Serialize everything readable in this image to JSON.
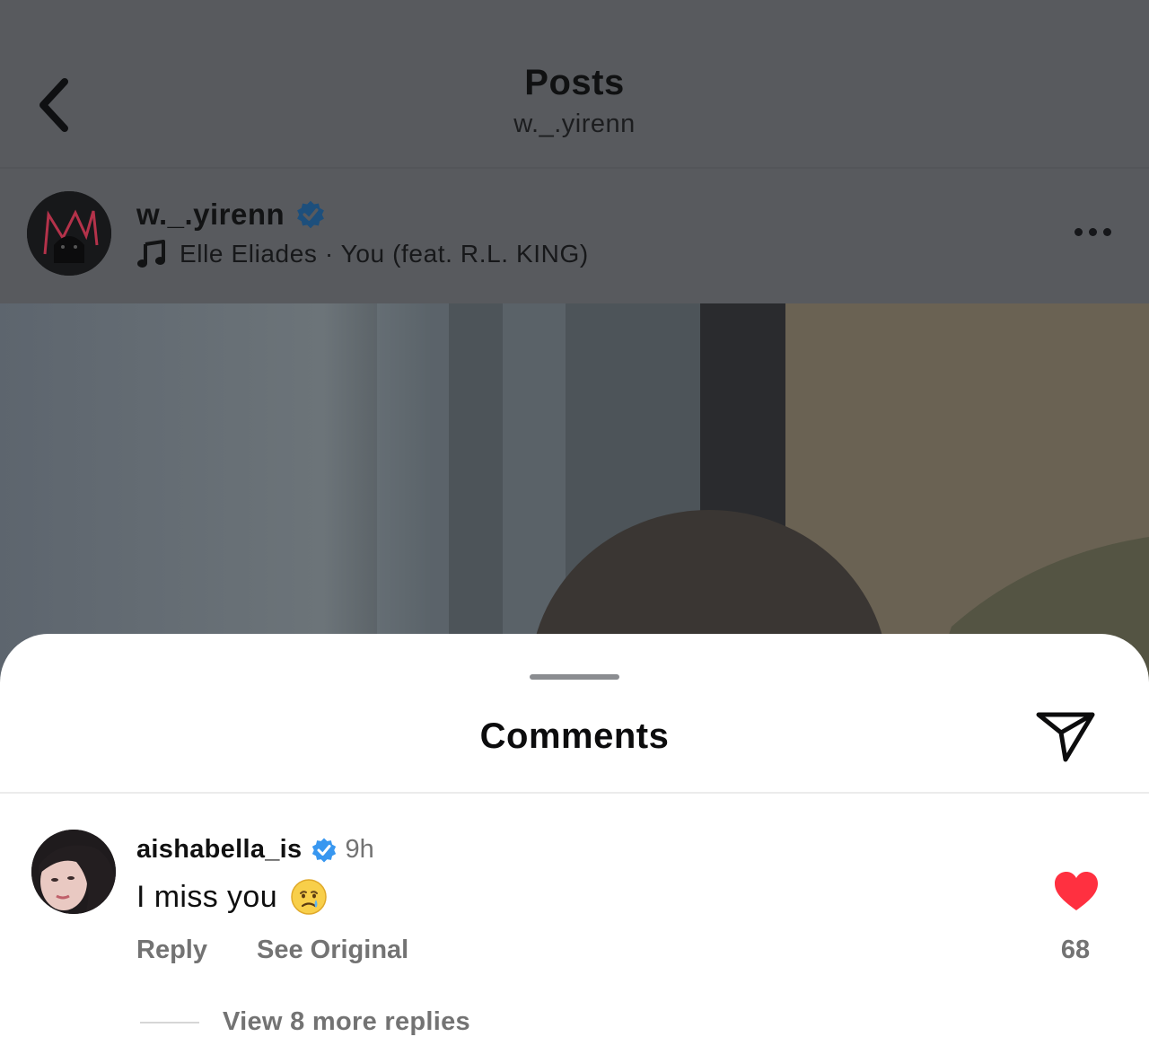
{
  "header": {
    "title": "Posts",
    "subtitle": "w._.yirenn"
  },
  "post": {
    "username": "w._.yirenn",
    "verified": true,
    "music": "Elle Eliades · You (feat. R.L. KING)"
  },
  "comments_sheet": {
    "title": "Comments",
    "comments": [
      {
        "username": "aishabella_is",
        "verified": true,
        "time": "9h",
        "text": "I miss you",
        "emoji": "crying-face",
        "reply_label": "Reply",
        "see_original_label": "See Original",
        "likes": "68",
        "liked": true,
        "view_replies_label": "View 8 more replies"
      }
    ]
  },
  "colors": {
    "overlay_background": "#585a5e",
    "verified_blue": "#3897f0",
    "like_red": "#ff3040",
    "secondary_text": "#737373"
  }
}
